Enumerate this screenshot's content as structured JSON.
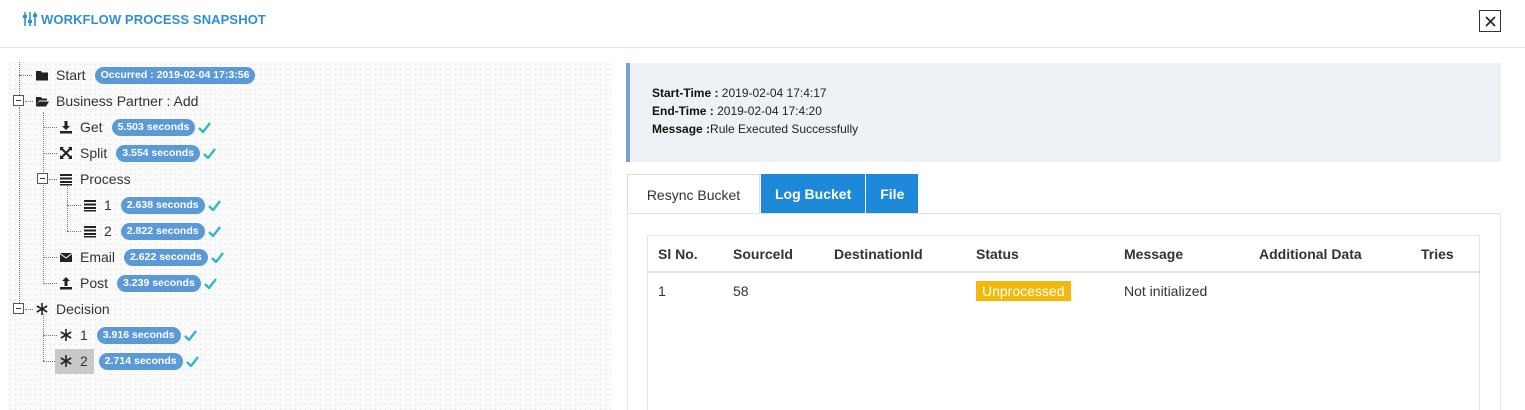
{
  "header": {
    "title": "WORKFLOW PROCESS SNAPSHOT",
    "title_icon": "sliders-icon",
    "close_icon": "close-icon"
  },
  "colors": {
    "accent": "#2f8fd5",
    "tab_active": "#1e88d9",
    "badge": "#5b9ad6",
    "check": "#31b8c8",
    "status_unprocessed": "#f0b90b"
  },
  "tree": {
    "start": {
      "label": "Start",
      "badge": "Occurred : 2019-02-04 17:3:56",
      "icon": "folder-icon"
    },
    "business_partner": {
      "label": "Business Partner : Add",
      "icon": "folder-open-icon",
      "children": {
        "get": {
          "label": "Get",
          "badge": "5.503 seconds",
          "icon": "download-icon"
        },
        "split": {
          "label": "Split",
          "badge": "3.554 seconds",
          "icon": "split-icon"
        },
        "process": {
          "label": "Process",
          "icon": "list-icon",
          "children": [
            {
              "label": "1",
              "badge": "2.638 seconds",
              "icon": "list-icon"
            },
            {
              "label": "2",
              "badge": "2.822 seconds",
              "icon": "list-icon"
            }
          ]
        },
        "email": {
          "label": "Email",
          "badge": "2.622 seconds",
          "icon": "envelope-icon"
        },
        "post": {
          "label": "Post",
          "badge": "3.239 seconds",
          "icon": "upload-icon"
        }
      }
    },
    "decision": {
      "label": "Decision",
      "icon": "snowflake-icon",
      "children": [
        {
          "label": "1",
          "badge": "3.916 seconds",
          "icon": "snowflake-icon"
        },
        {
          "label": "2",
          "badge": "2.714 seconds",
          "icon": "snowflake-icon"
        }
      ]
    }
  },
  "info": {
    "start_label": "Start-Time :",
    "start_value": " 2019-02-04 17:4:17",
    "end_label": "End-Time :",
    "end_value": " 2019-02-04 17:4:20",
    "message_label": "Message :",
    "message_value": "Rule Executed Successfully"
  },
  "tabs": [
    "Resync Bucket",
    "Log Bucket",
    "File"
  ],
  "table": {
    "columns": [
      "Sl No.",
      "SourceId",
      "DestinationId",
      "Status",
      "Message",
      "Additional Data",
      "Tries"
    ],
    "rows": [
      [
        "1",
        "58",
        "",
        "Unprocessed",
        "Not initialized",
        "",
        ""
      ]
    ]
  }
}
